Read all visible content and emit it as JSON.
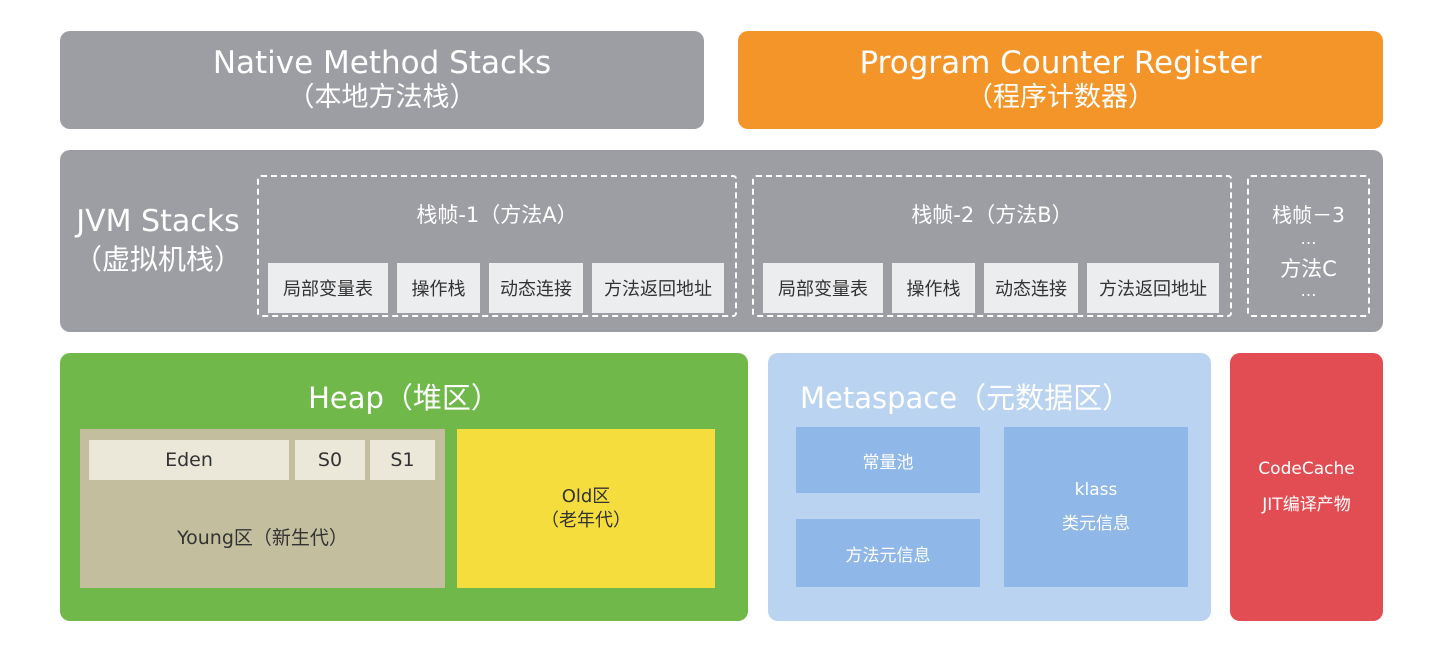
{
  "native_method_stacks": {
    "title_en": "Native Method Stacks",
    "title_cn": "（本地方法栈）"
  },
  "program_counter_register": {
    "title_en": "Program Counter Register",
    "title_cn": "（程序计数器）"
  },
  "jvm_stacks": {
    "title_en": "JVM Stacks",
    "title_cn": "（虚拟机栈）",
    "frames": [
      {
        "title": "栈帧-1（方法A）",
        "items": [
          "局部变量表",
          "操作栈",
          "动态连接",
          "方法返回地址"
        ]
      },
      {
        "title": "栈帧-2（方法B）",
        "items": [
          "局部变量表",
          "操作栈",
          "动态连接",
          "方法返回地址"
        ]
      }
    ],
    "frame3": {
      "title": "栈帧－3",
      "dots1": "…",
      "method": "方法C",
      "dots2": "…"
    }
  },
  "heap": {
    "title": "Heap（堆区）",
    "young": {
      "eden": "Eden",
      "s0": "S0",
      "s1": "S1",
      "label": "Young区（新生代）"
    },
    "old": {
      "line1": "Old区",
      "line2": "（老年代）"
    }
  },
  "metaspace": {
    "title": "Metaspace（元数据区）",
    "constant_pool": "常量池",
    "method_meta": "方法元信息",
    "klass_line1": "klass",
    "klass_line2": "类元信息"
  },
  "code_cache": {
    "line1": "CodeCache",
    "line2": "JIT编译产物"
  },
  "colors": {
    "gray_block": "#9d9ea3",
    "orange": "#f4952a",
    "green": "#70b84a",
    "young_tan": "#c3bf9e",
    "old_yellow": "#f4dd3d",
    "meta_light_blue": "#b9d3f0",
    "meta_cell_blue": "#8fb7e7",
    "codecache_red": "#e14d53"
  }
}
